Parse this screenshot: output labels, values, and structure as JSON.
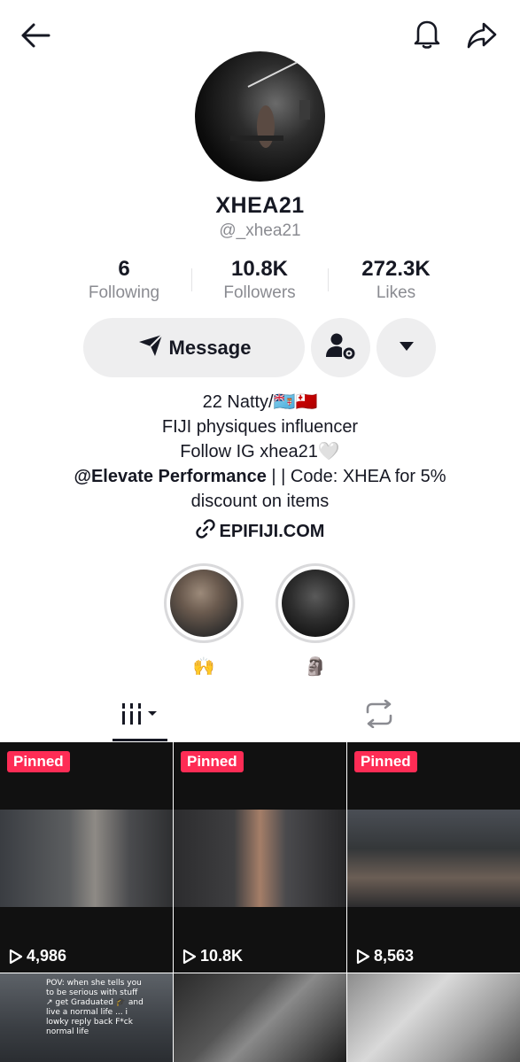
{
  "profile": {
    "display_name": "XHEA21",
    "handle": "@_xhea21"
  },
  "stats": [
    {
      "value": "6",
      "label": "Following"
    },
    {
      "value": "10.8K",
      "label": "Followers"
    },
    {
      "value": "272.3K",
      "label": "Likes"
    }
  ],
  "actions": {
    "message_label": "Message"
  },
  "bio": {
    "line1": "22 Natty/🇫🇯🇹🇴",
    "line2": "FIJI physiques influencer",
    "line3": "Follow IG xhea21🤍",
    "line4_bold": "@Elevate Performance",
    "line4_rest": " | | Code: XHEA for 5%",
    "line5": "discount on items",
    "link": "EPIFIJI.COM"
  },
  "highlights": [
    {
      "label": "🙌"
    },
    {
      "label": "🗿"
    }
  ],
  "videos": [
    {
      "pinned": "Pinned",
      "views": "4,986"
    },
    {
      "pinned": "Pinned",
      "views": "10.8K"
    },
    {
      "pinned": "Pinned",
      "views": "8,563"
    },
    {
      "caption": "POV: when she tells you to be serious with stuff ↗ get Graduated 🎓 and live a normal life ... i lowky reply back F*ck normal life"
    },
    {},
    {}
  ],
  "colors": {
    "accent": "#fe2c55",
    "text": "#161823",
    "muted": "#8a8b91",
    "button_bg": "#eeeeef"
  },
  "icons": [
    "back-arrow-icon",
    "bell-icon",
    "share-icon",
    "send-icon",
    "add-friend-icon",
    "dropdown-icon",
    "link-icon",
    "grid-videos-icon",
    "repost-icon",
    "play-icon"
  ]
}
